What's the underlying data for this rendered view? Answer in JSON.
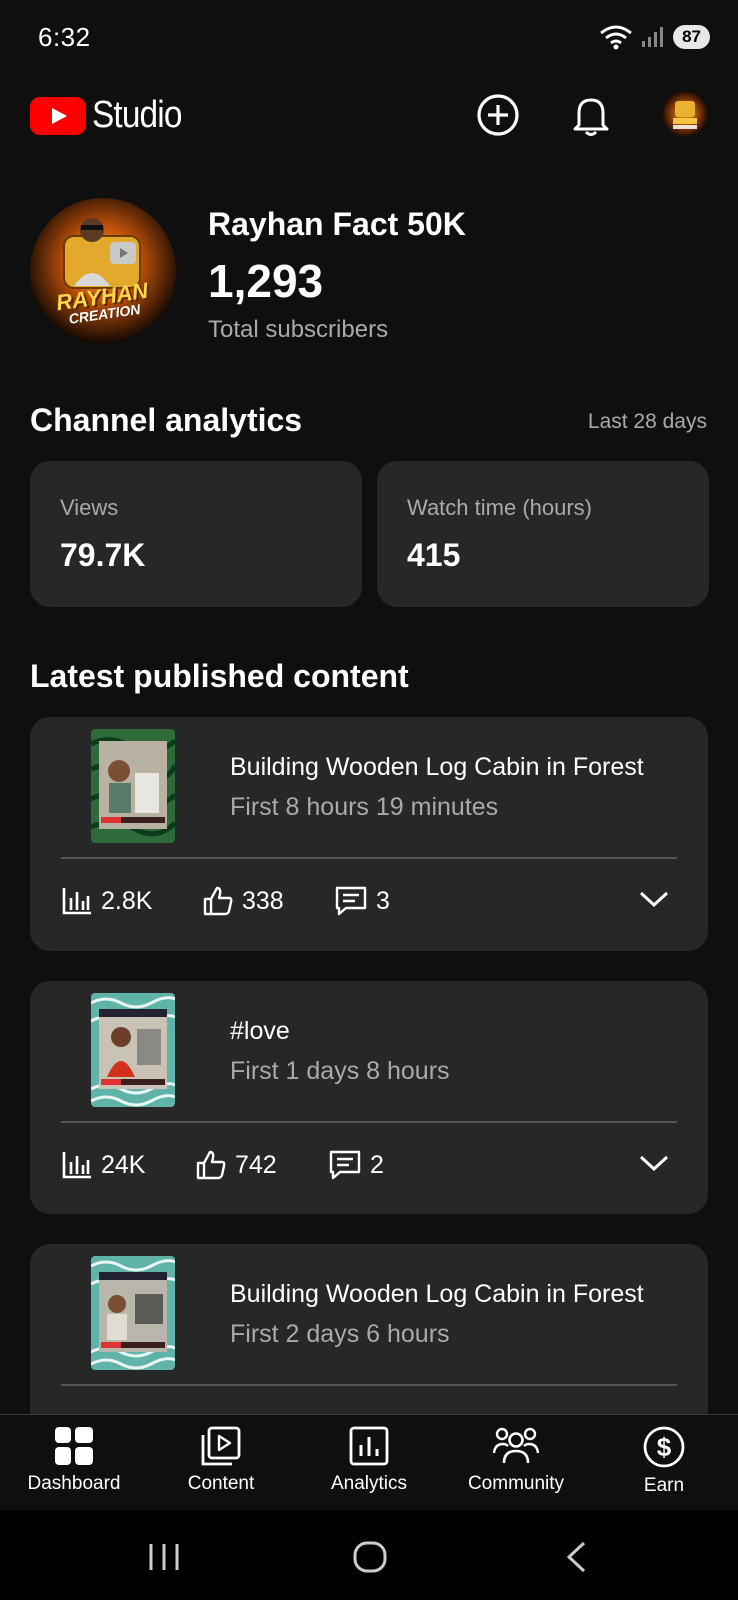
{
  "status_bar": {
    "time": "6:32",
    "battery": "87",
    "icons": [
      "wifi-icon",
      "signal-icon"
    ]
  },
  "header": {
    "logo_text": "Studio",
    "icons": [
      "create-icon",
      "notifications-icon",
      "account-avatar"
    ]
  },
  "channel": {
    "name": "Rayhan Fact 50K",
    "subscriber_count": "1,293",
    "subscriber_label": "Total subscribers",
    "avatar_text_1": "RAYHAN",
    "avatar_text_2": "CREATION"
  },
  "analytics": {
    "title": "Channel analytics",
    "period": "Last 28 days",
    "cards": [
      {
        "label": "Views",
        "value": "79.7K"
      },
      {
        "label": "Watch time (hours)",
        "value": "415"
      }
    ]
  },
  "latest": {
    "title": "Latest published content",
    "videos": [
      {
        "title": "Building Wooden Log Cabin in Forest",
        "subtitle": "First 8 hours 19 minutes",
        "views": "2.8K",
        "likes": "338",
        "comments": "3"
      },
      {
        "title": "#love",
        "subtitle": "First 1 days 8 hours",
        "views": "24K",
        "likes": "742",
        "comments": "2"
      },
      {
        "title": "Building Wooden Log Cabin in Forest",
        "subtitle": "First 2 days 6 hours"
      }
    ]
  },
  "bottom_nav": {
    "items": [
      {
        "label": "Dashboard",
        "icon": "dashboard-icon"
      },
      {
        "label": "Content",
        "icon": "content-icon"
      },
      {
        "label": "Analytics",
        "icon": "analytics-icon"
      },
      {
        "label": "Community",
        "icon": "community-icon"
      },
      {
        "label": "Earn",
        "icon": "earn-icon"
      }
    ]
  },
  "colors": {
    "background": "#0f0f0f",
    "card": "#272727",
    "brand_red": "#ff0000",
    "secondary_text": "#aaaaaa"
  }
}
